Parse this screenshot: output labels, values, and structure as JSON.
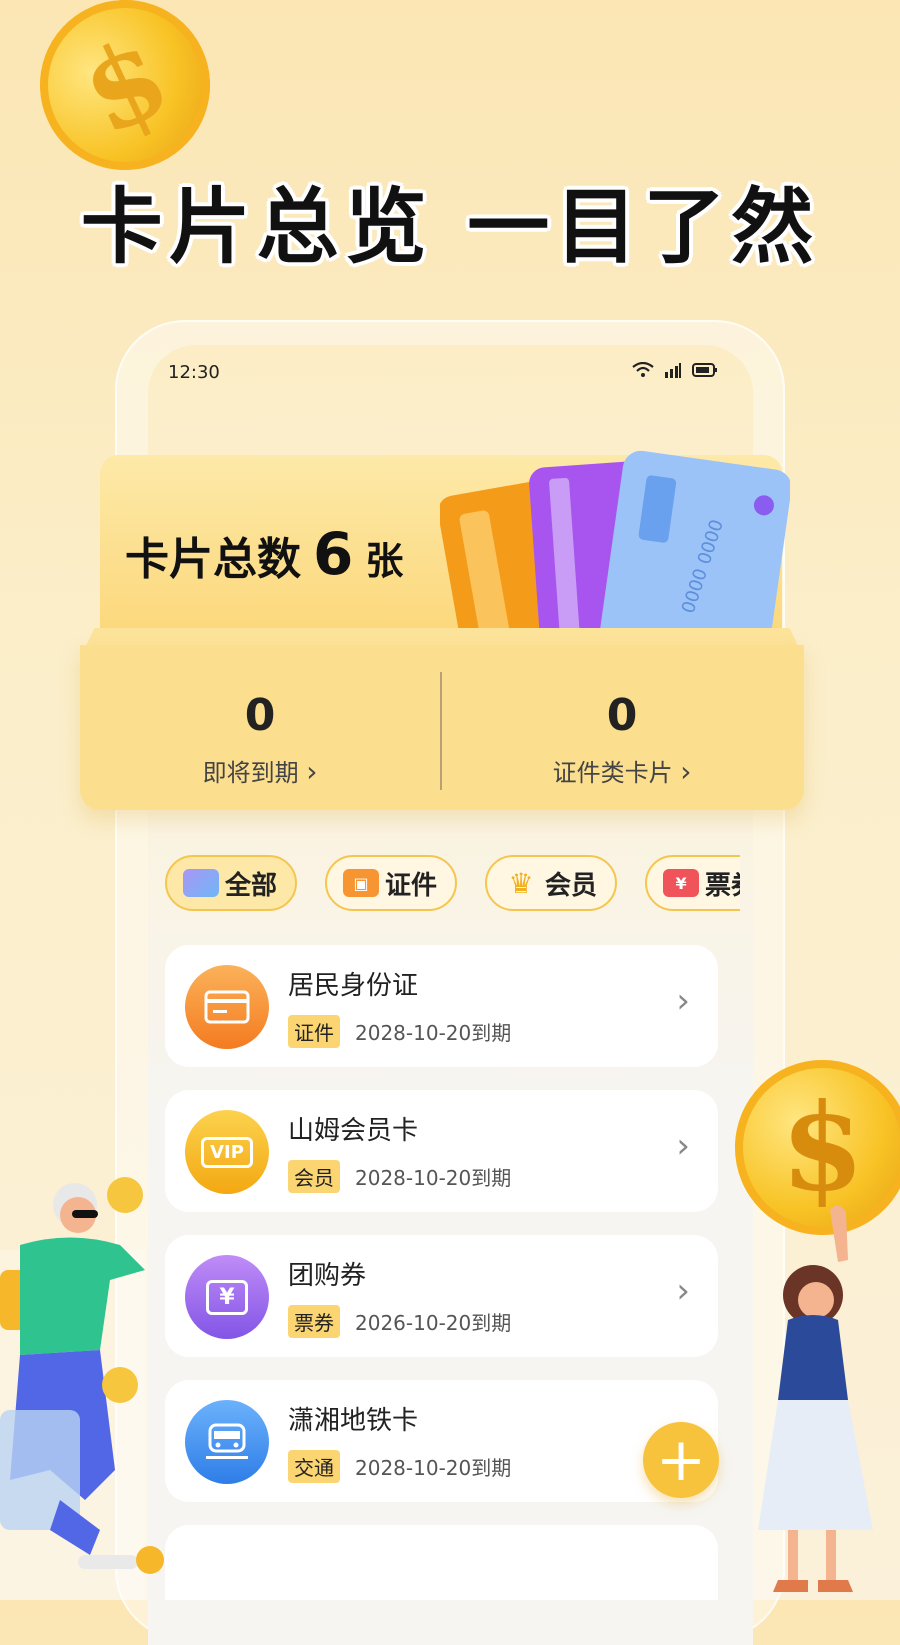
{
  "headline": "卡片总览  一目了然",
  "status": {
    "time": "12:30"
  },
  "summary": {
    "label": "卡片总数",
    "count": "6",
    "unit": "张",
    "expiring_count": "0",
    "expiring_label": "即将到期",
    "id_cards_count": "0",
    "id_cards_label": "证件类卡片"
  },
  "tabs": [
    {
      "label": "全部",
      "icon": "card-icon"
    },
    {
      "label": "证件",
      "icon": "id-card-icon"
    },
    {
      "label": "会员",
      "icon": "crown-icon"
    },
    {
      "label": "票券",
      "icon": "ticket-icon",
      "icon_text": "¥"
    }
  ],
  "items": [
    {
      "title": "居民身份证",
      "badge": "证件",
      "date": "2028-10-20到期",
      "icon": "id-card-icon",
      "color": "#f79533"
    },
    {
      "title": "山姆会员卡",
      "badge": "会员",
      "date": "2028-10-20到期",
      "icon": "vip-icon",
      "icon_text": "VIP",
      "color": "#f5b81f"
    },
    {
      "title": "团购券",
      "badge": "票券",
      "date": "2026-10-20到期",
      "icon": "coupon-icon",
      "icon_text": "¥",
      "color": "#9b6cf0"
    },
    {
      "title": "潇湘地铁卡",
      "badge": "交通",
      "date": "2028-10-20到期",
      "icon": "train-icon",
      "color": "#3f8ef0"
    }
  ],
  "coin_symbol": "$",
  "fab": "+",
  "colors": {
    "accent": "#f7c23c",
    "background": "#fbe6b4",
    "badge": "#fbd572"
  }
}
